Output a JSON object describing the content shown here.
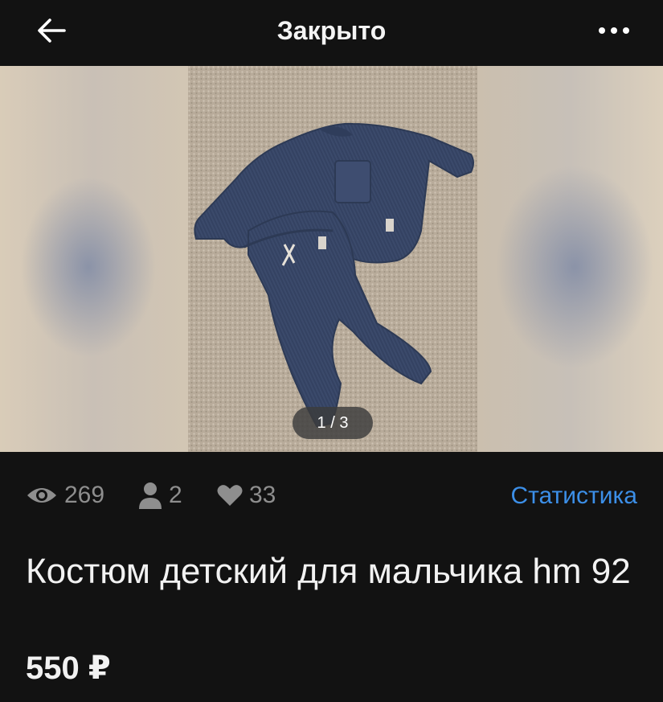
{
  "header": {
    "title": "Закрыто",
    "back_icon": "arrow-left-icon",
    "more_icon": "more-horizontal-icon"
  },
  "gallery": {
    "counter": "1 / 3",
    "current_index": 1,
    "total": 3
  },
  "stats": {
    "views": "269",
    "contacts": "2",
    "favorites": "33",
    "statistics_link": "Статистика",
    "views_icon": "eye-icon",
    "contacts_icon": "person-icon",
    "favorites_icon": "heart-icon"
  },
  "product": {
    "title": "Костюм детский для мальчика hm 92",
    "price": "550 ₽"
  },
  "colors": {
    "background": "#121212",
    "link": "#3c8fe8",
    "muted": "#8e8e8e"
  }
}
